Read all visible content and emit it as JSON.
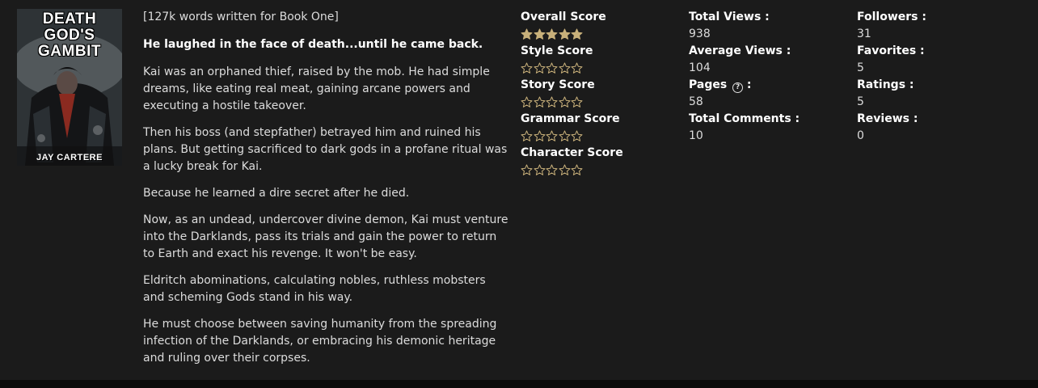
{
  "cover": {
    "title_line1": "DEATH",
    "title_line2": "GOD'S",
    "title_line3": "GAMBIT",
    "author": "JAY CARTERE"
  },
  "description": {
    "word_count": "[127k words written for Book One]",
    "tagline": "He laughed in the face of death...until he came back.",
    "paragraphs": [
      "Kai was an orphaned thief, raised by the mob. He had simple dreams, like eating real meat, gaining arcane powers and executing a hostile takeover.",
      "Then his boss (and stepfather) betrayed him and ruined his plans. But getting sacrificed to dark gods in a profane ritual was a lucky break for Kai.",
      "Because he learned a dire secret after he died.",
      "Now, as an undead, undercover divine demon, Kai must venture into the Darklands, pass its trials and gain the power to return to Earth and exact his revenge. It won't be easy.",
      "Eldritch abominations, calculating nobles, ruthless mobsters and scheming Gods stand in his way.",
      "He must choose between saving humanity from the spreading infection of the Darklands, or embracing his demonic heritage and ruling over their corpses."
    ]
  },
  "scores": {
    "overall": {
      "label": "Overall Score",
      "stars": 5
    },
    "style": {
      "label": "Style Score",
      "stars": 0
    },
    "story": {
      "label": "Story Score",
      "stars": 0
    },
    "grammar": {
      "label": "Grammar Score",
      "stars": 0
    },
    "character": {
      "label": "Character Score",
      "stars": 0
    },
    "star_color": "#c8b07a"
  },
  "stats": {
    "total_views": {
      "label": "Total Views :",
      "value": "938"
    },
    "average_views": {
      "label": "Average Views :",
      "value": "104"
    },
    "pages": {
      "label": "Pages",
      "suffix": " :",
      "help_icon": "?",
      "value": "58"
    },
    "total_comments": {
      "label": "Total Comments :",
      "value": "10"
    },
    "followers": {
      "label": "Followers :",
      "value": "31"
    },
    "favorites": {
      "label": "Favorites :",
      "value": "5"
    },
    "ratings": {
      "label": "Ratings :",
      "value": "5"
    },
    "reviews": {
      "label": "Reviews :",
      "value": "0"
    }
  }
}
